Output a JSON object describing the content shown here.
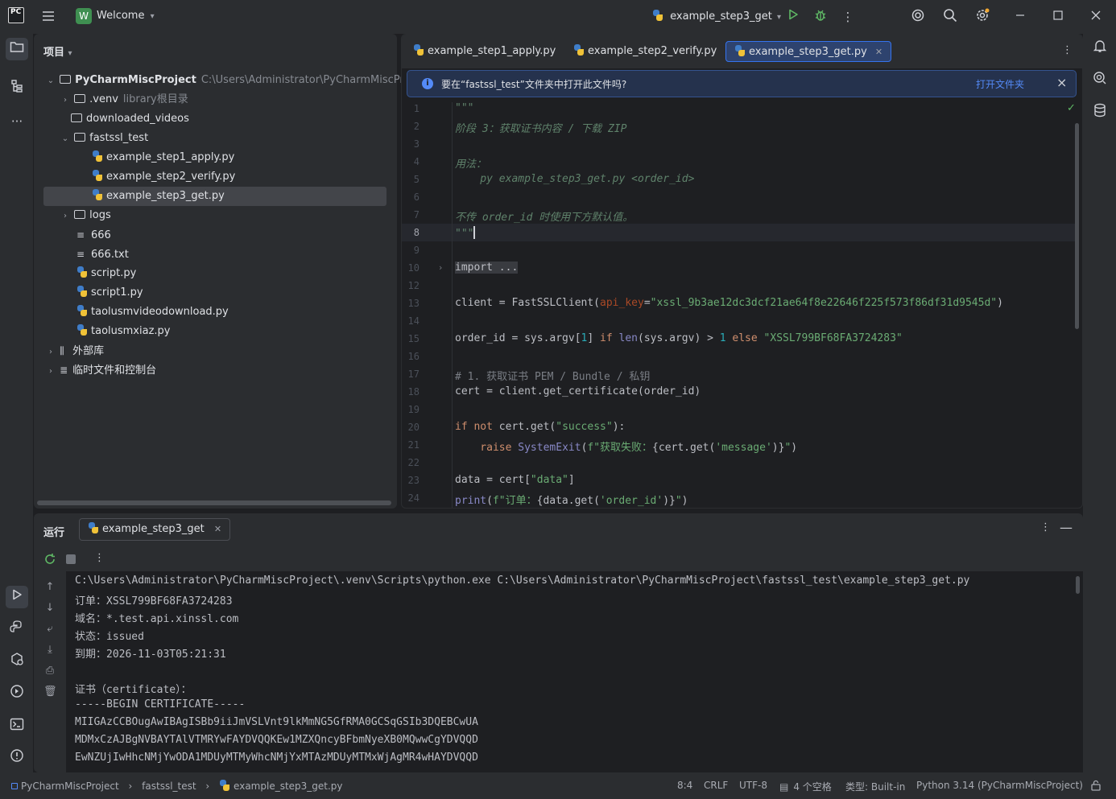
{
  "titlebar": {
    "logo": "PC",
    "project_badge": "W",
    "project_name": "Welcome",
    "run_config": "example_step3_get",
    "window_controls": [
      "minimize",
      "maximize",
      "close"
    ]
  },
  "project_panel": {
    "header": "项目",
    "tree": [
      {
        "label": "PyCharmMiscProject",
        "hint": "C:\\Users\\Administrator\\PyCharmMiscProject",
        "type": "root"
      },
      {
        "label": ".venv",
        "hint": "library根目录",
        "type": "folder"
      },
      {
        "label": "downloaded_videos",
        "hint": "",
        "type": "folder"
      },
      {
        "label": "fastssl_test",
        "hint": "",
        "type": "folder"
      },
      {
        "label": "example_step1_apply.py",
        "hint": "",
        "type": "python"
      },
      {
        "label": "example_step2_verify.py",
        "hint": "",
        "type": "python"
      },
      {
        "label": "example_step3_get.py",
        "hint": "",
        "type": "python",
        "selected": true
      },
      {
        "label": "logs",
        "hint": "",
        "type": "folder"
      },
      {
        "label": "666",
        "hint": "",
        "type": "text"
      },
      {
        "label": "666.txt",
        "hint": "",
        "type": "text"
      },
      {
        "label": "script.py",
        "hint": "",
        "type": "python"
      },
      {
        "label": "script1.py",
        "hint": "",
        "type": "python"
      },
      {
        "label": "taolusmvideodownload.py",
        "hint": "",
        "type": "python"
      },
      {
        "label": "taolusmxiaz.py",
        "hint": "",
        "type": "python"
      },
      {
        "label": "外部库",
        "hint": "",
        "type": "library"
      },
      {
        "label": "临时文件和控制台",
        "hint": "",
        "type": "scratch"
      }
    ]
  },
  "editor": {
    "tabs": [
      "example_step1_apply.py",
      "example_step2_verify.py",
      "example_step3_get.py"
    ],
    "active_tab": "example_step3_get.py",
    "notice": {
      "message": "要在“fastssl_test”文件夹中打开此文件吗?",
      "link": "打开文件夹"
    },
    "line_numbers": [
      "1",
      "2",
      "3",
      "4",
      "5",
      "6",
      "7",
      "8",
      "9",
      "10",
      "12",
      "13",
      "14",
      "15",
      "16",
      "17",
      "18",
      "19",
      "20",
      "21",
      "22",
      "23",
      "24"
    ],
    "current_line": "8",
    "code": {
      "l1": "\"\"\"",
      "l2": "阶段 3：获取证书内容 / 下载 ZIP",
      "l4": "用法：",
      "l5": "    py example_step3_get.py <order_id>",
      "l7": "不传 order_id 时使用下方默认值。",
      "l8": "\"\"\"",
      "l10": "import ...",
      "l13_a": "client = FastSSLClient(",
      "l13_param": "api_key",
      "l13_eq": "=",
      "l13_str": "\"xssl_9b3ae12dc3dcf21ae64f8e22646f225f573f86df31d9545d\"",
      "l13_end": ")",
      "l15_a": "order_id = sys.argv[",
      "l15_n1": "1",
      "l15_b": "] ",
      "l15_if": "if",
      "l15_sp": " ",
      "l15_len": "len",
      "l15_c": "(sys.argv) > ",
      "l15_n2": "1",
      "l15_sp2": " ",
      "l15_else": "else",
      "l15_sp3": " ",
      "l15_str": "\"XSSL799BF68FA3724283\"",
      "l17": "# 1. 获取证书 PEM / Bundle / 私钥",
      "l18": "cert = client.get_certificate(order_id)",
      "l20_if": "if",
      "l20_not": " not",
      "l20_a": " cert.get(",
      "l20_str": "\"success\"",
      "l20_end": "):",
      "l21_raise": "    raise",
      "l21_sp": " ",
      "l21_exc": "SystemExit",
      "l21_a": "(",
      "l21_f": "f\"获取失败：",
      "l21_b": "{cert.get(",
      "l21_s2": "'message'",
      "l21_c": ")}",
      "l21_q": "\"",
      "l21_end": ")",
      "l23_a": "data = cert[",
      "l23_str": "\"data\"",
      "l23_end": "]",
      "l24_print": "print",
      "l24_a": "(",
      "l24_f": "f\"订单：",
      "l24_b": "{data.get(",
      "l24_s2": "'order_id'",
      "l24_c": ")}",
      "l24_q": "\"",
      "l24_end": ")"
    }
  },
  "run_panel": {
    "title": "运行",
    "tab": "example_step3_get",
    "console": [
      "C:\\Users\\Administrator\\PyCharmMiscProject\\.venv\\Scripts\\python.exe C:\\Users\\Administrator\\PyCharmMiscProject\\fastssl_test\\example_step3_get.py",
      "订单：XSSL799BF68FA3724283",
      "域名：*.test.api.xinssl.com",
      "状态：issued",
      "到期：2026-11-03T05:21:31",
      "",
      "证书（certificate）：",
      "-----BEGIN CERTIFICATE-----",
      "MIIGAzCCBOugAwIBAgISBb9iiJmVSLVnt9lkMmNG5GfRMA0GCSqGSIb3DQEBCwUA",
      "MDMxCzAJBgNVBAYTAlVTMRYwFAYDVQQKEw1MZXQncyBFbmNyeXB0MQwwCgYDVQQD",
      "EwNZUjIwHhcNMjYwODA1MDUyMTMyWhcNMjYxMTAzMDUyMTMxWjAgMR4wHAYDVQQD"
    ]
  },
  "statusbar": {
    "breadcrumb": [
      "PyCharmMiscProject",
      "fastssl_test",
      "example_step3_get.py"
    ],
    "position": "8:4",
    "line_ending": "CRLF",
    "encoding": "UTF-8",
    "indent": "4 个空格",
    "file_type": "类型: Built-in",
    "interpreter": "Python 3.14 (PyCharmMiscProject)"
  }
}
